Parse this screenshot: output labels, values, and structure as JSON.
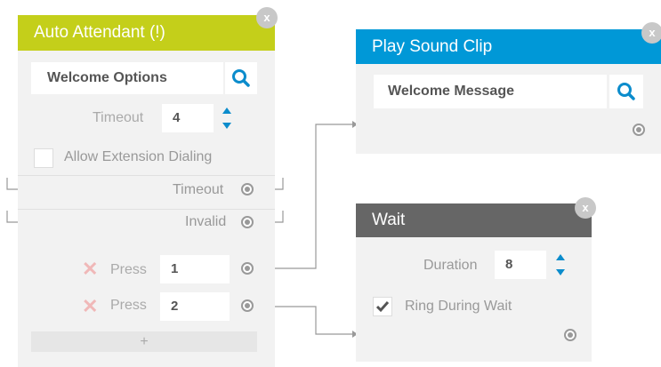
{
  "auto_attendant": {
    "title": "Auto Attendant (!)",
    "header_color": "#c4cf1a",
    "close_label": "x",
    "welcome_field": "Welcome Options",
    "timeout_label": "Timeout",
    "timeout_value": "4",
    "allow_ext_label": "Allow Extension Dialing",
    "allow_ext_checked": false,
    "outputs": [
      {
        "label": "Timeout"
      },
      {
        "label": "Invalid"
      }
    ],
    "presses": [
      {
        "label": "Press",
        "value": "1"
      },
      {
        "label": "Press",
        "value": "2"
      }
    ],
    "add_label": "+"
  },
  "play_sound": {
    "title": "Play Sound Clip",
    "header_color": "#0098d7",
    "close_label": "x",
    "field": "Welcome Message"
  },
  "wait": {
    "title": "Wait",
    "header_color": "#666666",
    "close_label": "x",
    "duration_label": "Duration",
    "duration_value": "8",
    "ring_label": "Ring During Wait",
    "ring_checked": true
  },
  "icons": {
    "search": "search-icon",
    "close": "close-icon",
    "stepper": "stepper-icon",
    "port": "port-icon",
    "remove": "remove-icon",
    "check": "check-icon"
  },
  "accent": "#0b8ccc"
}
